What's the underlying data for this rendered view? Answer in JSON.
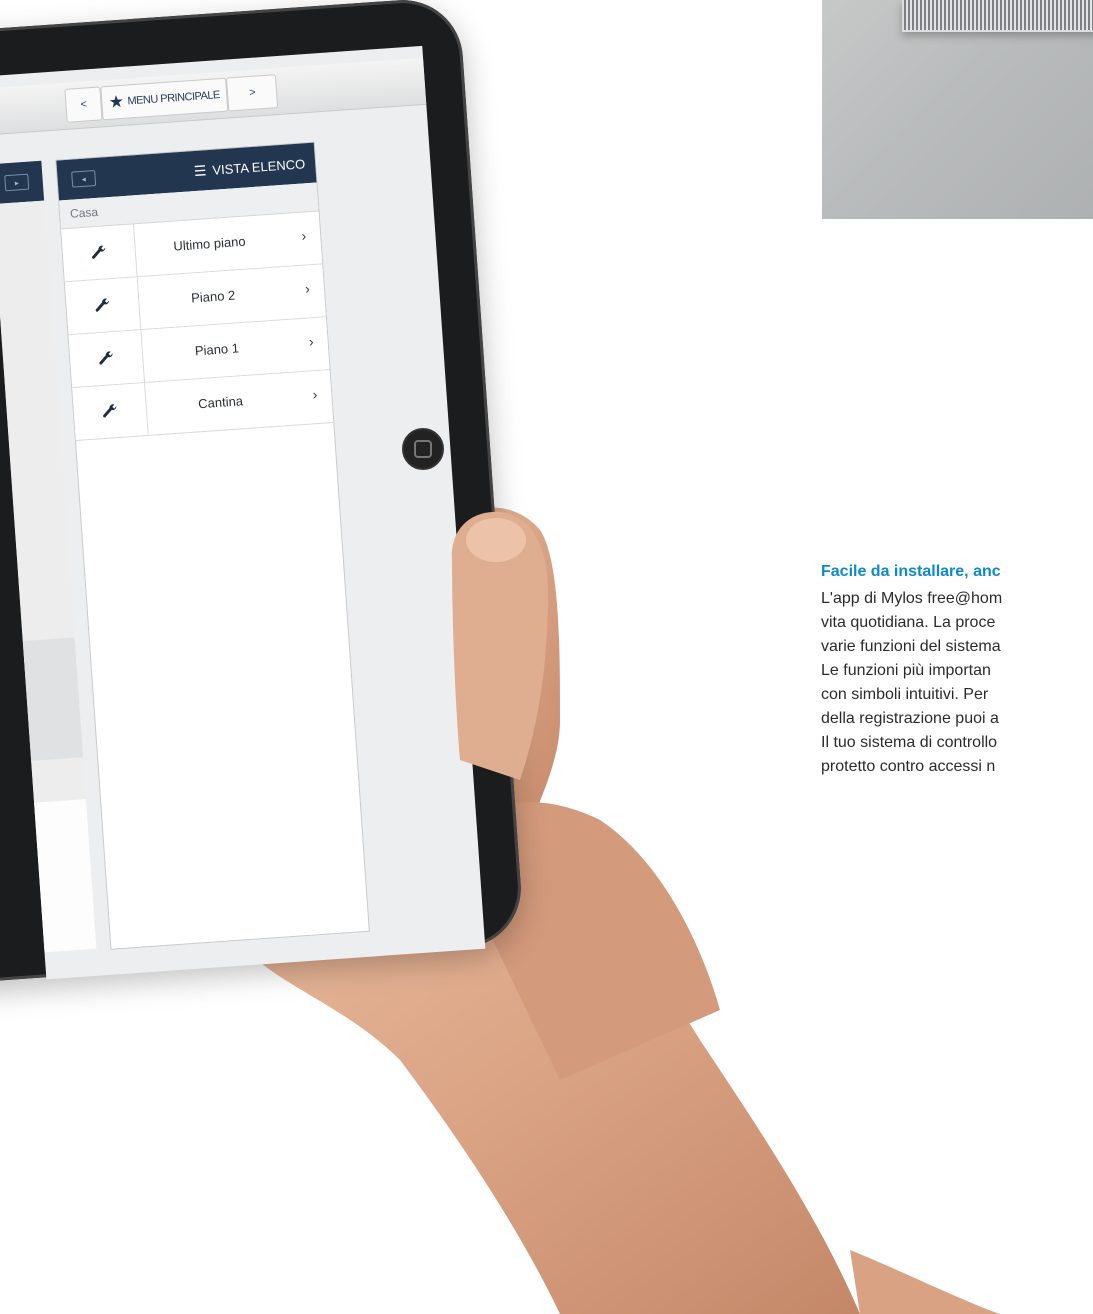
{
  "navbar": {
    "prev": "<",
    "main": "MENU PRINCIPALE",
    "next": ">"
  },
  "list_view": {
    "title": "VISTA ELENCO",
    "breadcrumb": "Casa",
    "items": [
      {
        "label": "Ultimo piano"
      },
      {
        "label": "Piano 2"
      },
      {
        "label": "Piano 1"
      },
      {
        "label": "Cantina"
      }
    ]
  },
  "article": {
    "heading": "Facile da installare, anc",
    "lines": [
      "L'app di Mylos free@hom",
      "vita quotidiana. La proce",
      "varie funzioni del sistema",
      "Le funzioni più importan",
      "con simboli intuitivi. Per",
      "della registrazione puoi a",
      "Il tuo sistema di controllo",
      "protetto contro accessi n"
    ]
  },
  "colors": {
    "navy": "#22364f",
    "accent_blue": "#0e89cd"
  }
}
